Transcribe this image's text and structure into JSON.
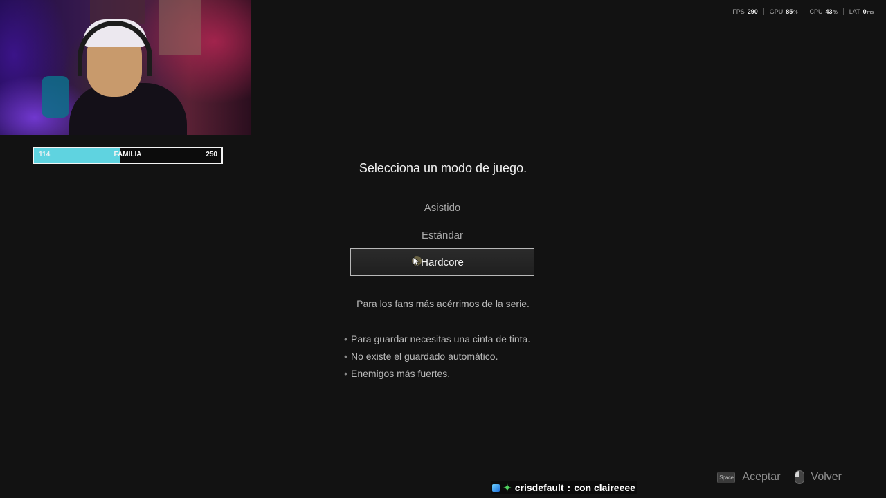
{
  "stats": [
    {
      "name": "FPS",
      "value": "290",
      "unit": ""
    },
    {
      "name": "GPU",
      "value": "85",
      "unit": "%"
    },
    {
      "name": "CPU",
      "value": "43",
      "unit": "%"
    },
    {
      "name": "LAT",
      "value": "0",
      "unit": "ms"
    }
  ],
  "goal": {
    "current": "114",
    "label": "FAMILIA",
    "target": "250",
    "progress": 0.456,
    "color": "#5fd3e0"
  },
  "menu": {
    "title": "Selecciona un modo de juego.",
    "options": [
      {
        "label": "Asistido",
        "selected": false
      },
      {
        "label": "Estándar",
        "selected": false
      },
      {
        "label": "Hardcore",
        "selected": true
      }
    ],
    "description": "Para los fans más acérrimos de la serie.",
    "bullets": [
      "Para guardar necesitas una cinta de tinta.",
      "No existe el guardado automático.",
      "Enemigos más fuertes."
    ]
  },
  "controls": {
    "accept_key": "Space",
    "accept_label": "Aceptar",
    "back_icon": "mouse-right-icon",
    "back_label": "Volver"
  },
  "chat": {
    "username": "crisdefault",
    "separator": ":",
    "message": "con claireeee"
  }
}
